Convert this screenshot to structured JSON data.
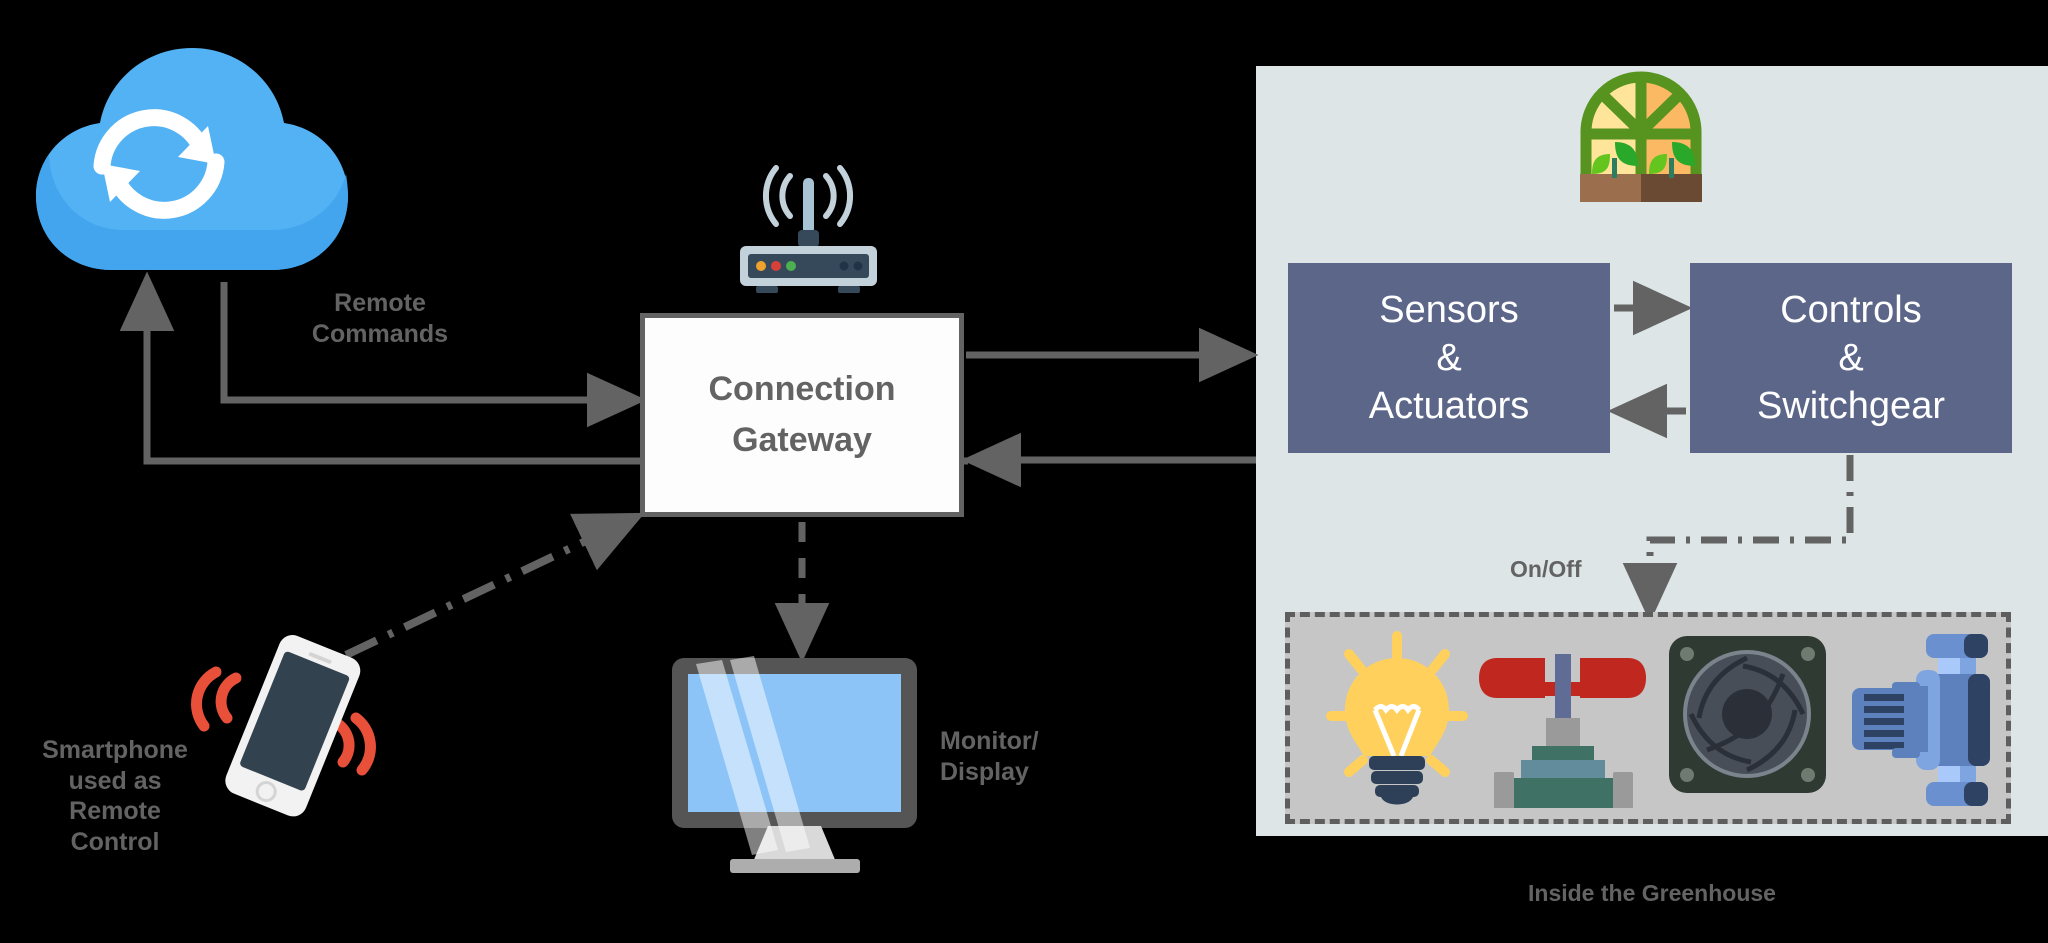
{
  "diagram": {
    "title": "Greenhouse IoT remote control architecture",
    "background_color": "#000000"
  },
  "nodes": {
    "cloud": {
      "name": "cloud-sync",
      "icon": "cloud-sync-icon"
    },
    "router": {
      "name": "wireless-router",
      "icon": "wifi-router-icon"
    },
    "gateway": {
      "label_line1": "Connection",
      "label_line2": "Gateway"
    },
    "monitor": {
      "icon": "monitor-icon",
      "label_line1": "Monitor/",
      "label_line2": "Display"
    },
    "smartphone": {
      "icon": "smartphone-icon",
      "label_line1": "Smartphone",
      "label_line2": "used as",
      "label_line3": "Remote",
      "label_line4": "Control"
    },
    "sensors": {
      "line1": "Sensors",
      "line2": "&",
      "line3": "Actuators"
    },
    "controls": {
      "line1": "Controls",
      "line2": "&",
      "line3": "Switchgear"
    },
    "greenhouse_icon": {
      "name": "greenhouse-icon"
    },
    "equipment": {
      "items": [
        "light-bulb-icon",
        "valve-icon",
        "fan-icon",
        "pump-motor-icon"
      ]
    }
  },
  "labels": {
    "remote_commands_line1": "Remote",
    "remote_commands_line2": "Commands",
    "on_off": "On/Off",
    "inside_greenhouse": "Inside the Greenhouse"
  },
  "colors": {
    "background": "#000000",
    "panel_fill": "#dde5e7",
    "block_fill": "#5c6688",
    "block_text": "#ffffff",
    "line": "#636363",
    "label_text": "#636363",
    "gateway_fill": "#fdfdfd",
    "equipment_fill": "#c6c6c6",
    "cloud_blue": "#53b2f4",
    "screen_blue": "#8cc4f8",
    "bulb_yellow": "#ffd15c",
    "valve_red": "#c0271f",
    "valve_green": "#3f7265",
    "phone_red": "#e8503a",
    "greenhouse_green": "#57941f"
  }
}
